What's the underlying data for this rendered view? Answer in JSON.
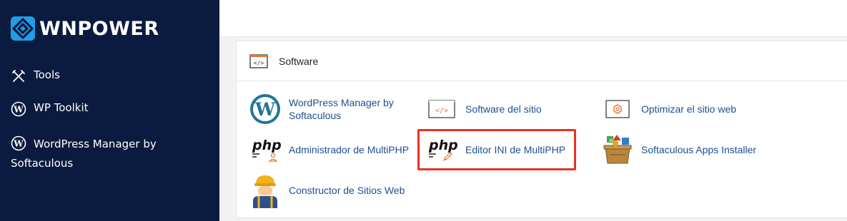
{
  "brand": {
    "name": "WNPOWER",
    "accent": "#1d9ee6"
  },
  "sidebar": {
    "background": "#0b1b3f",
    "items": [
      {
        "label": "Tools",
        "icon": "tools-icon"
      },
      {
        "label": "WP Toolkit",
        "icon": "wordpress-icon"
      },
      {
        "label": "WordPress Manager by",
        "label_line2": "Softaculous",
        "icon": "wordpress-icon"
      }
    ]
  },
  "panel": {
    "title": "Software",
    "items": [
      {
        "label": "WordPress Manager by Softaculous",
        "icon": "wordpress-logo-icon"
      },
      {
        "label": "Software del sitio",
        "icon": "code-icon"
      },
      {
        "label": "Optimizar el sitio web",
        "icon": "optimize-icon"
      },
      {
        "label": "Administrador de MultiPHP",
        "icon": "php-manager-icon",
        "icon_text": "php"
      },
      {
        "label": "Editor INI de MultiPHP",
        "icon": "php-ini-editor-icon",
        "icon_text": "php"
      },
      {
        "label": "Softaculous Apps Installer",
        "icon": "softaculous-icon"
      },
      {
        "label": "Constructor de Sitios Web",
        "icon": "site-builder-worker-icon"
      }
    ]
  },
  "colors": {
    "link": "#1d4f91",
    "highlight": "#e8321f"
  }
}
